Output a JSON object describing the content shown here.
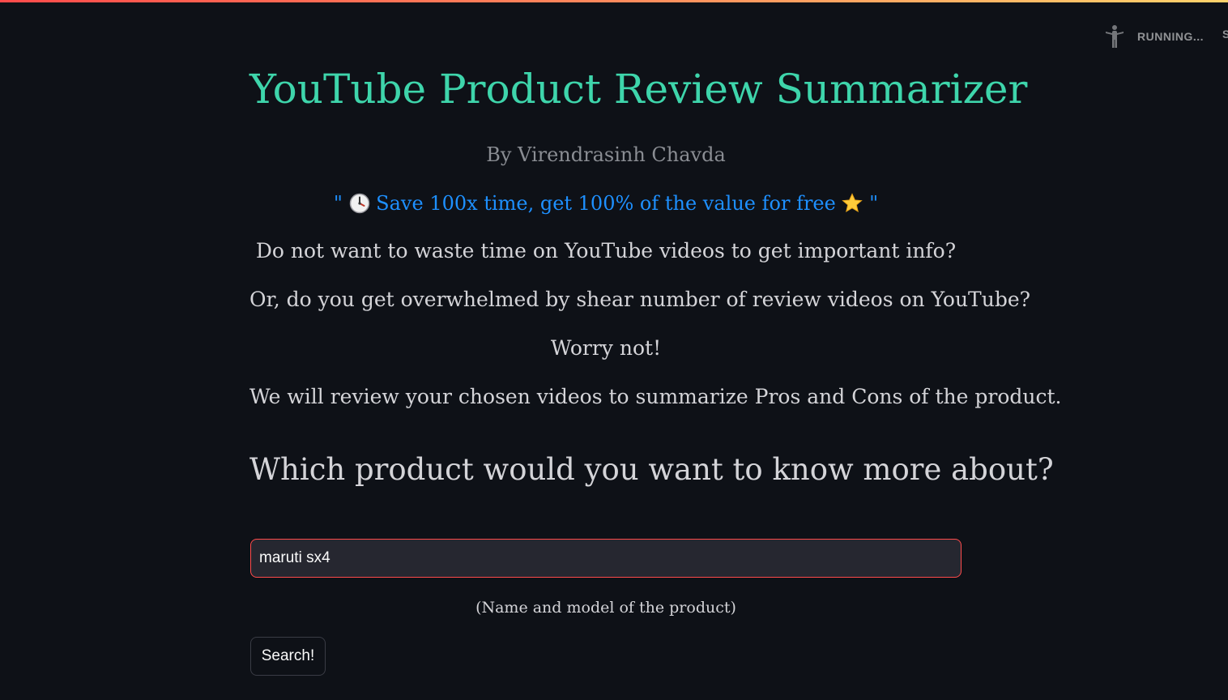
{
  "status": {
    "icon": "running-figure-icon",
    "text": "RUNNING..."
  },
  "colors": {
    "background": "#0e1117",
    "title": "#3ed5ab",
    "tagline": "#1e90ff",
    "byline": "#8a8d93",
    "text": "#d4d4d8",
    "input_border": "#ff4b4b",
    "input_background": "#262730"
  },
  "header": {
    "title": "YouTube Product Review Summarizer",
    "byline": "By Virendrasinh Chavda"
  },
  "tagline": {
    "open_quote": "\"",
    "icon_left": "clock-emoji-icon",
    "text": "Save 100x time, get 100% of the value for free",
    "icon_right": "star-emoji-icon",
    "close_quote": "\""
  },
  "intro": {
    "line1": "Do not want to waste time on YouTube videos to get important info?",
    "line2": "Or, do you get overwhelmed by shear number of review videos on YouTube?",
    "line3": "Worry not!",
    "line4": "We will review your chosen videos to summarize Pros and Cons of the product."
  },
  "form": {
    "question": "Which product would you want to know more about?",
    "input_value": "maruti sx4",
    "caption": "(Name and model of the product)",
    "button_label": "Search!"
  }
}
